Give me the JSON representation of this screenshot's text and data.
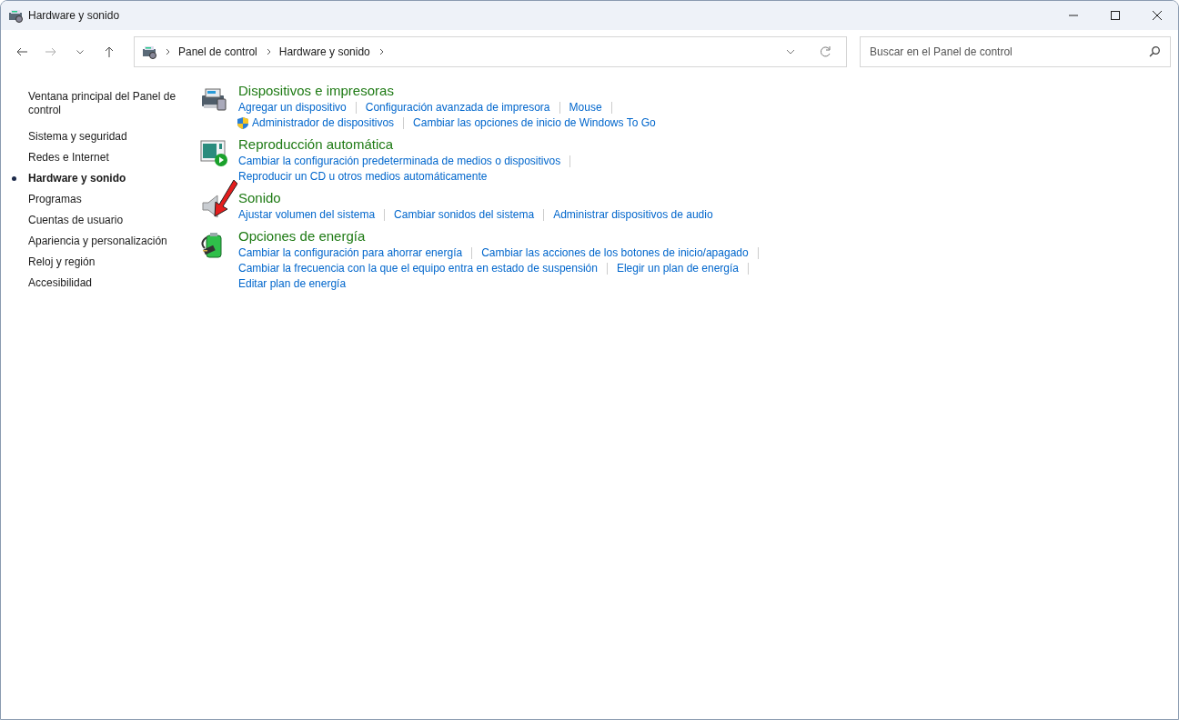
{
  "window": {
    "title": "Hardware y sonido"
  },
  "address_bar": {
    "crumbs": [
      "Panel de control",
      "Hardware y sonido"
    ]
  },
  "search": {
    "placeholder": "Buscar en el Panel de control"
  },
  "sidebar": {
    "home": "Ventana principal del Panel de control",
    "items": [
      {
        "label": "Sistema y seguridad",
        "selected": false
      },
      {
        "label": "Redes e Internet",
        "selected": false
      },
      {
        "label": "Hardware y sonido",
        "selected": true
      },
      {
        "label": "Programas",
        "selected": false
      },
      {
        "label": "Cuentas de usuario",
        "selected": false
      },
      {
        "label": "Apariencia y personalización",
        "selected": false
      },
      {
        "label": "Reloj y región",
        "selected": false
      },
      {
        "label": "Accesibilidad",
        "selected": false
      }
    ]
  },
  "sections": [
    {
      "kind": "devices",
      "title": "Dispositivos e impresoras",
      "lines": [
        [
          {
            "label": "Agregar un dispositivo",
            "kind": "plain"
          },
          {
            "label": "Configuración avanzada de impresora",
            "kind": "plain"
          },
          {
            "label": "Mouse",
            "kind": "plain"
          }
        ],
        [
          {
            "label": "Administrador de dispositivos",
            "kind": "admin"
          },
          {
            "label": "Cambiar las opciones de inicio de Windows To Go",
            "kind": "plain"
          }
        ]
      ]
    },
    {
      "kind": "autoplay",
      "title": "Reproducción automática",
      "lines": [
        [
          {
            "label": "Cambiar la configuración predeterminada de medios o dispositivos",
            "kind": "plain"
          }
        ],
        [
          {
            "label": "Reproducir un CD u otros medios automáticamente",
            "kind": "plain"
          }
        ]
      ]
    },
    {
      "kind": "sound",
      "title": "Sonido",
      "lines": [
        [
          {
            "label": "Ajustar volumen del sistema",
            "kind": "plain"
          },
          {
            "label": "Cambiar sonidos del sistema",
            "kind": "plain"
          },
          {
            "label": "Administrar dispositivos de audio",
            "kind": "plain"
          }
        ]
      ]
    },
    {
      "kind": "power",
      "title": "Opciones de energía",
      "lines": [
        [
          {
            "label": "Cambiar la configuración para ahorrar energía",
            "kind": "plain"
          },
          {
            "label": "Cambiar las acciones de los botones de inicio/apagado",
            "kind": "plain"
          }
        ],
        [
          {
            "label": "Cambiar la frecuencia con la que el equipo entra en estado de suspensión",
            "kind": "plain"
          },
          {
            "label": "Elegir un plan de energía",
            "kind": "plain"
          }
        ],
        [
          {
            "label": "Editar plan de energía",
            "kind": "plain"
          }
        ]
      ]
    }
  ]
}
